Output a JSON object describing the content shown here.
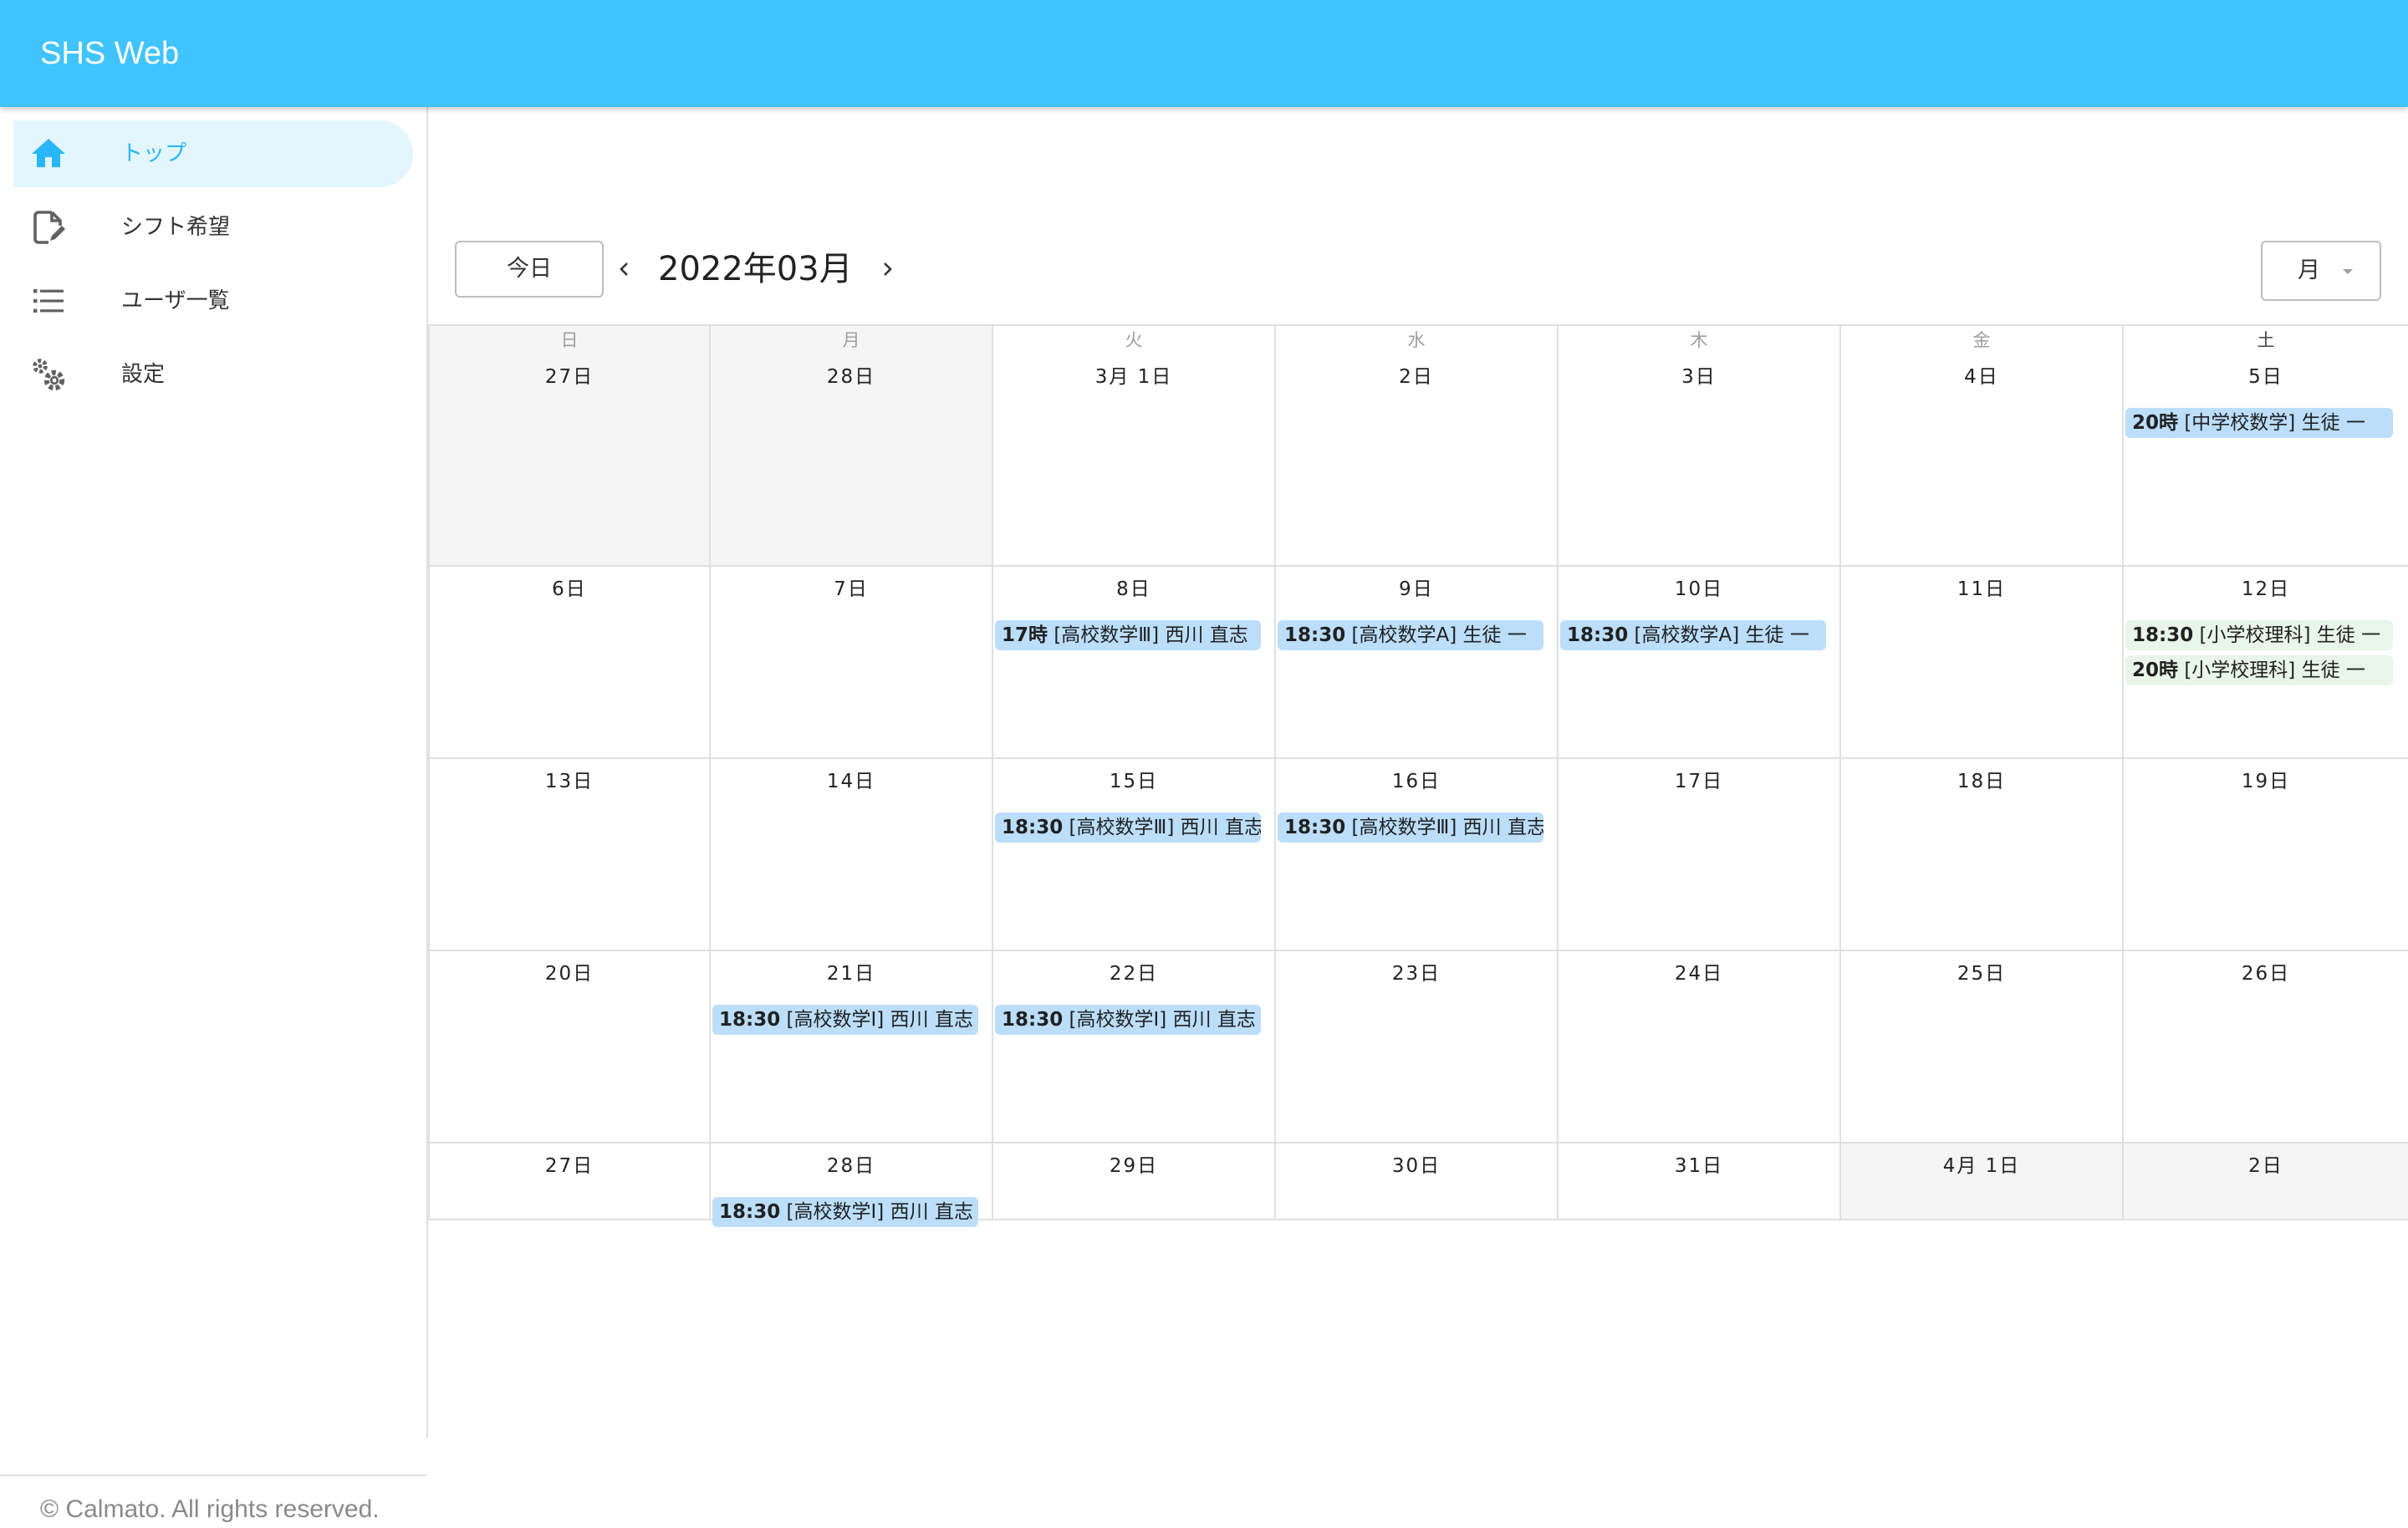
{
  "app": {
    "title": "SHS Web"
  },
  "sidebar": {
    "items": [
      {
        "label": "トップ",
        "icon": "home-icon",
        "active": true
      },
      {
        "label": "シフト希望",
        "icon": "edit-document-icon",
        "active": false
      },
      {
        "label": "ユーザ一覧",
        "icon": "list-icon",
        "active": false
      },
      {
        "label": "設定",
        "icon": "settings-gears-icon",
        "active": false
      }
    ],
    "footer": "© Calmato. All rights reserved."
  },
  "toolbar": {
    "today_label": "今日",
    "period": "2022年03月",
    "view_value": "月",
    "prev_icon": "chevron-left-icon",
    "next_icon": "chevron-right-icon"
  },
  "calendar": {
    "weekdays": [
      "日",
      "月",
      "火",
      "水",
      "木",
      "金",
      "土"
    ],
    "weeks": [
      {
        "days": [
          {
            "label": "27日",
            "outside": true,
            "events": []
          },
          {
            "label": "28日",
            "outside": true,
            "events": []
          },
          {
            "label": "3月 1日",
            "events": []
          },
          {
            "label": "2日",
            "events": []
          },
          {
            "label": "3日",
            "events": []
          },
          {
            "label": "4日",
            "events": []
          },
          {
            "label": "5日",
            "events": [
              {
                "time": "20時",
                "text": "[中学校数学] 生徒 一",
                "color": "blue"
              }
            ]
          }
        ]
      },
      {
        "days": [
          {
            "label": "6日",
            "events": []
          },
          {
            "label": "7日",
            "events": []
          },
          {
            "label": "8日",
            "events": [
              {
                "time": "17時",
                "text": "[高校数学Ⅲ] 西川 直志",
                "color": "blue"
              }
            ]
          },
          {
            "label": "9日",
            "events": [
              {
                "time": "18:30",
                "text": "[高校数学A] 生徒 一",
                "color": "blue"
              }
            ]
          },
          {
            "label": "10日",
            "events": [
              {
                "time": "18:30",
                "text": "[高校数学A] 生徒 一",
                "color": "blue"
              }
            ]
          },
          {
            "label": "11日",
            "events": []
          },
          {
            "label": "12日",
            "events": [
              {
                "time": "18:30",
                "text": "[小学校理科] 生徒 一",
                "color": "green"
              },
              {
                "time": "20時",
                "text": "[小学校理科] 生徒 一",
                "color": "green"
              }
            ]
          }
        ]
      },
      {
        "days": [
          {
            "label": "13日",
            "events": []
          },
          {
            "label": "14日",
            "events": []
          },
          {
            "label": "15日",
            "events": [
              {
                "time": "18:30",
                "text": "[高校数学Ⅲ] 西川 直志",
                "color": "blue"
              }
            ]
          },
          {
            "label": "16日",
            "events": [
              {
                "time": "18:30",
                "text": "[高校数学Ⅲ] 西川 直志",
                "color": "blue"
              }
            ]
          },
          {
            "label": "17日",
            "events": []
          },
          {
            "label": "18日",
            "events": []
          },
          {
            "label": "19日",
            "events": []
          }
        ]
      },
      {
        "days": [
          {
            "label": "20日",
            "events": []
          },
          {
            "label": "21日",
            "events": [
              {
                "time": "18:30",
                "text": "[高校数学Ⅰ] 西川 直志",
                "color": "blue"
              }
            ]
          },
          {
            "label": "22日",
            "events": [
              {
                "time": "18:30",
                "text": "[高校数学Ⅰ] 西川 直志",
                "color": "blue"
              }
            ]
          },
          {
            "label": "23日",
            "events": []
          },
          {
            "label": "24日",
            "events": []
          },
          {
            "label": "25日",
            "events": []
          },
          {
            "label": "26日",
            "events": []
          }
        ]
      },
      {
        "days": [
          {
            "label": "27日",
            "events": []
          },
          {
            "label": "28日",
            "events": [
              {
                "time": "18:30",
                "text": "[高校数学Ⅰ] 西川 直志",
                "color": "blue"
              }
            ]
          },
          {
            "label": "29日",
            "events": []
          },
          {
            "label": "30日",
            "events": []
          },
          {
            "label": "31日",
            "events": []
          },
          {
            "label": "4月 1日",
            "outside": true,
            "events": []
          },
          {
            "label": "2日",
            "outside": true,
            "events": []
          }
        ]
      }
    ]
  },
  "colors": {
    "appbar": "#40c4ff",
    "accent": "#29b6f6",
    "event_blue": "#bbdefb",
    "event_green": "#e8f5e9",
    "outside_day": "#f5f5f5"
  }
}
